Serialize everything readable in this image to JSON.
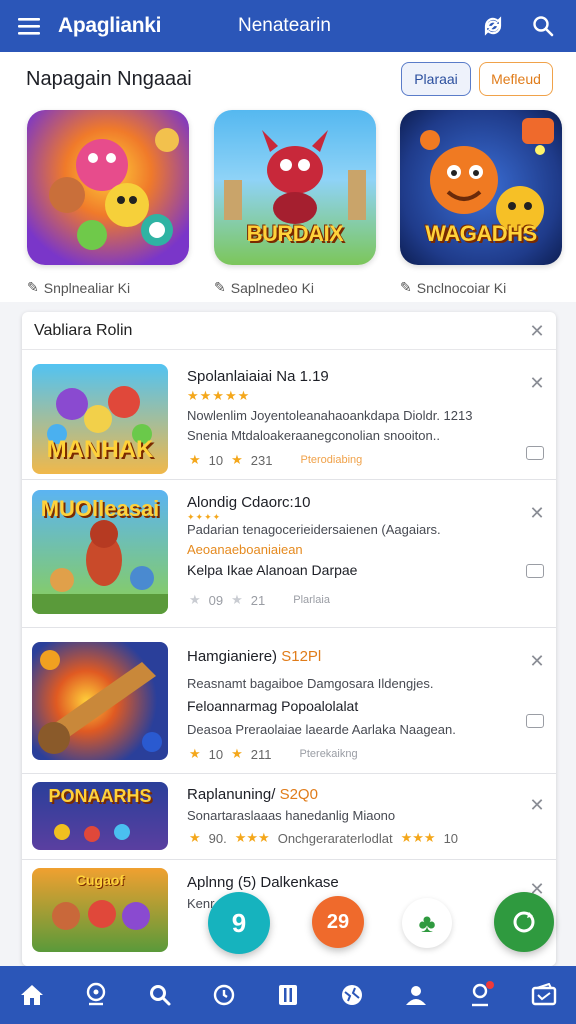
{
  "topbar": {
    "brand": "Apaglianki",
    "center_title": "Nenatearin",
    "icons": [
      "menu-icon",
      "refresh-icon",
      "search-icon"
    ]
  },
  "featured": {
    "title": "Napagain Nngaaai",
    "pill_a": "Plaraai",
    "pill_b": "Mefleud",
    "cards": [
      {
        "logo": "",
        "caption": "Snplnealiar Ki"
      },
      {
        "logo": "BURDAIX",
        "caption": "Saplnedeo Ki"
      },
      {
        "logo": "WAGADHS",
        "caption": "Snclnocoiar Ki"
      }
    ]
  },
  "panel": {
    "title": "Vabliara Rolin",
    "rows": [
      {
        "logo": "MANHAK",
        "title": "Spolanlaiaiai Na 1.19",
        "line1": "Nowlenlim Joyentoleanahaoankdapa Dioldr. 1213",
        "line2": "Snenia Mtdaloakeraanegconolian snooiton..",
        "rating1": "10",
        "rating2": "231",
        "tag": "Pterodiabing"
      },
      {
        "logo": "MUOlleasai",
        "title": "Alondig Cdaorc:10",
        "line1": "Padarian tenagocerieidersaienen (Aagaiars.",
        "line2": "Aeoanaeboaniaiean",
        "line3": "Kelpa Ikae Alanoan Darpae",
        "rating1": "09",
        "rating2": "21",
        "tag": "Plarlaia"
      },
      {
        "title_prefix": "Hamgianiere)",
        "title_highlight": "S12Pl",
        "line1": "Reasnamt bagaiboe Damgosara Ildengjes.",
        "line2": "Feloannarmag Popoalolalat",
        "line3": "Deasoa Preraolaiae laearde Aarlaka Naagean.",
        "rating1": "10",
        "rating2": "211",
        "tag": "Pterekaikng"
      },
      {
        "logo": "PONAARHS",
        "title_prefix": "Raplanuning/",
        "title_highlight": "S2Q0",
        "line1": "Sonartaraslaaas hanedanlig Miaono",
        "line2_prefix": "90.",
        "line2_text": "Onchgeraraterlodlat",
        "line2_suffix": "10"
      },
      {
        "logo": "Cugaof",
        "title": "Aplnng (5) Dalkenkase",
        "line1": "Kenr"
      }
    ]
  },
  "fabs": [
    {
      "label": "9",
      "color": "#16b3be"
    },
    {
      "label": "29",
      "color": "#ef6a2c"
    },
    {
      "label": "",
      "color": "#ffffff"
    },
    {
      "label": "",
      "color": "#2f9a3f"
    }
  ],
  "bottomnav": [
    "home-icon",
    "location-icon",
    "search-icon",
    "clock-icon",
    "pause-icon",
    "globe-icon",
    "users-icon",
    "profile-icon",
    "wallet-icon"
  ]
}
